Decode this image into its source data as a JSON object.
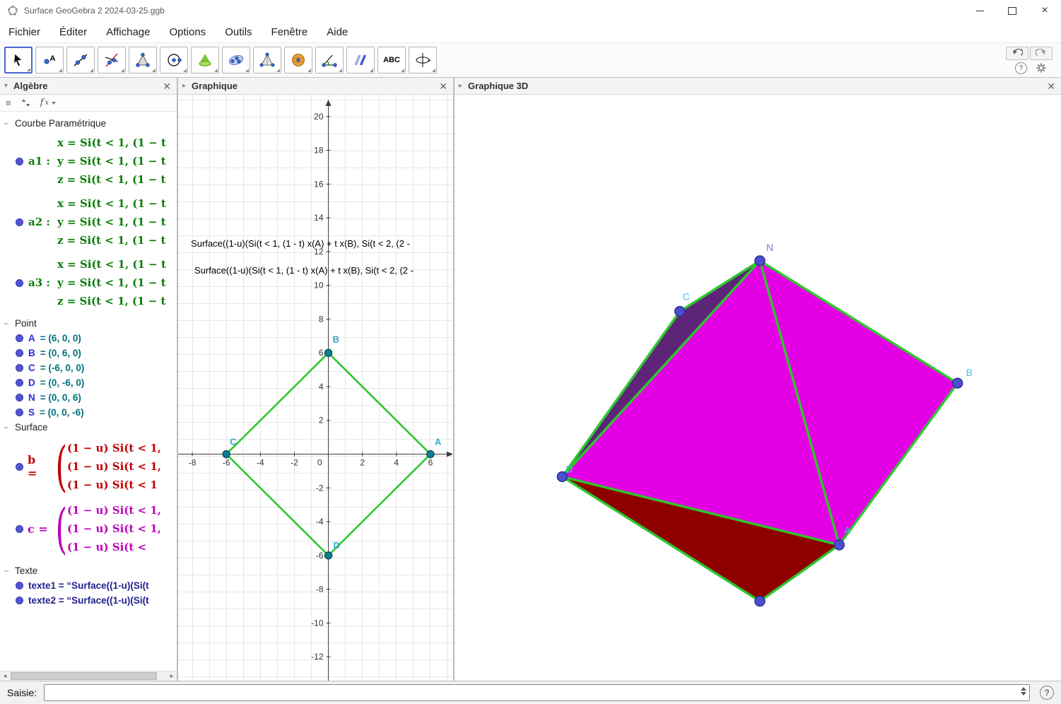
{
  "titlebar": {
    "title": "Surface GeoGebra 2 2024-03-25.ggb"
  },
  "menubar": {
    "items": [
      "Fichier",
      "Éditer",
      "Affichage",
      "Options",
      "Outils",
      "Fenêtre",
      "Aide"
    ]
  },
  "toolbar": {
    "abc_label": "ABC",
    "tools": [
      {
        "icon": "move-cursor-icon",
        "selected": true
      },
      {
        "icon": "point-icon"
      },
      {
        "icon": "line-icon"
      },
      {
        "icon": "perpendicular-line-icon"
      },
      {
        "icon": "polygon-icon"
      },
      {
        "icon": "circle-icon"
      },
      {
        "icon": "surface-of-revolution-icon"
      },
      {
        "icon": "plane-icon"
      },
      {
        "icon": "pyramid-icon"
      },
      {
        "icon": "sphere-icon"
      },
      {
        "icon": "angle-icon"
      },
      {
        "icon": "transform-icon"
      },
      {
        "icon": "text-icon"
      },
      {
        "icon": "rotate-3d-view-icon"
      }
    ]
  },
  "algebra": {
    "title": "Algèbre",
    "curves": {
      "title": "Courbe Paramétrique",
      "items": [
        {
          "label": "a1 :",
          "x": "x = Si(t < 1, (1 − t",
          "y": "y = Si(t < 1, (1 − t",
          "z": "z = Si(t < 1, (1 − t"
        },
        {
          "label": "a2 :",
          "x": "x = Si(t < 1, (1 − t",
          "y": "y = Si(t < 1, (1 − t",
          "z": "z = Si(t < 1, (1 − t"
        },
        {
          "label": "a3 :",
          "x": "x = Si(t < 1, (1 − t",
          "y": "y = Si(t < 1, (1 − t",
          "z": "z = Si(t < 1, (1 − t"
        }
      ]
    },
    "points": {
      "title": "Point",
      "items": [
        {
          "label": "A",
          "value": "= (6, 0, 0)"
        },
        {
          "label": "B",
          "value": "= (0, 6, 0)"
        },
        {
          "label": "C",
          "value": "= (-6, 0, 0)"
        },
        {
          "label": "D",
          "value": "= (0, -6, 0)"
        },
        {
          "label": "N",
          "value": "= (0, 0, 6)"
        },
        {
          "label": "S",
          "value": "= (0, 0, -6)"
        }
      ]
    },
    "surfaces": {
      "title": "Surface",
      "items": [
        {
          "label": "b",
          "eq": "=",
          "lines": [
            "(1 − u) Si(t < 1,",
            "(1 − u) Si(t < 1,",
            "(1 − u) Si(t < 1"
          ]
        },
        {
          "label": "c",
          "eq": "=",
          "lines": [
            "(1 − u) Si(t < 1,",
            "(1 − u) Si(t < 1,",
            "(1 − u) Si(t <"
          ]
        }
      ]
    },
    "texts": {
      "title": "Texte",
      "items": [
        {
          "text": "texte1 = “Surface((1-u)(Si(t"
        },
        {
          "text": "texte2 = “Surface((1-u)(Si(t"
        }
      ]
    }
  },
  "graph2d": {
    "title": "Graphique",
    "overlay_texts": [
      "Surface((1-u)(Si(t < 1, (1 - t) x(A) + t x(B), Si(t < 2, (2 -",
      "Surface((1-u)(Si(t < 1, (1 - t) x(A) + t x(B), Si(t < 2, (2 -"
    ],
    "x_ticks": [
      "-8",
      "-6",
      "-4",
      "-2",
      "0",
      "2",
      "4",
      "6"
    ],
    "y_ticks": [
      "20",
      "18",
      "16",
      "14",
      "12",
      "10",
      "8",
      "6",
      "4",
      "2",
      "-2",
      "-4",
      "-6",
      "-8",
      "-10",
      "-12"
    ],
    "point_labels": [
      "A",
      "B",
      "C",
      "D"
    ]
  },
  "graph3d": {
    "title": "Graphique 3D",
    "point_labels": [
      "N",
      "C",
      "B",
      "D",
      "A"
    ]
  },
  "inputbar": {
    "label": "Saisie:"
  },
  "colors": {
    "curve_green": "#067d06",
    "point_teal": "#0f7f93",
    "surface_red": "#c00000",
    "surface_magenta": "#bb00bb",
    "text_navy": "#20208f",
    "edge_green": "#2ec72e",
    "face_magenta": "#e400e4",
    "face_dark_red": "#8e0000",
    "face_dark_purple": "#5e2478",
    "vertex_blue": "#4d4fd2"
  }
}
